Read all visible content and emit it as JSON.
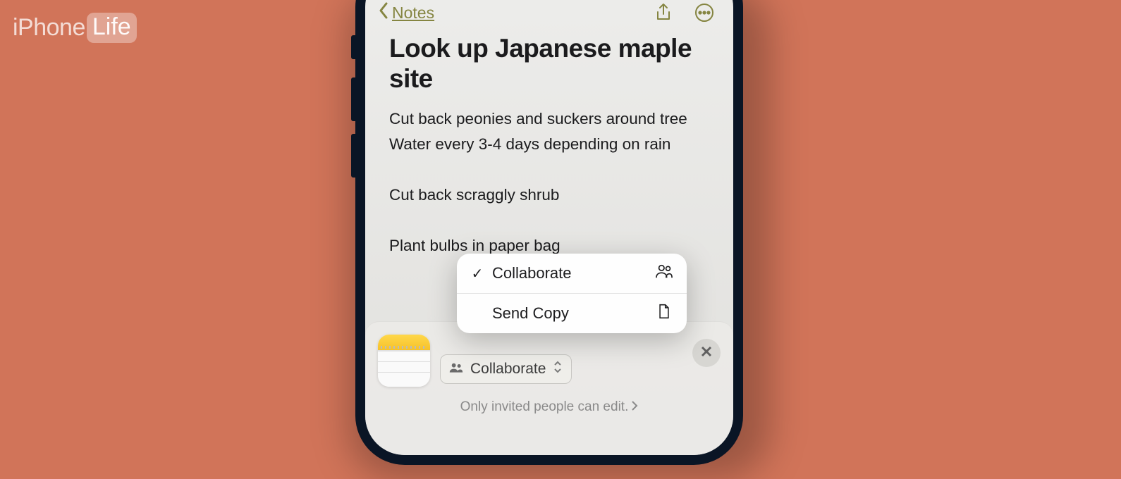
{
  "watermark": {
    "brand_left": "iPhone",
    "brand_right": "Life"
  },
  "nav": {
    "back_label": "Notes"
  },
  "note": {
    "title": "Look up Japanese maple site",
    "lines": [
      "Cut back peonies and suckers around tree",
      "Water every 3-4 days depending on rain",
      "",
      "Cut back scraggly shrub",
      "",
      "Plant bulbs in paper bag"
    ]
  },
  "popup": {
    "options": [
      {
        "label": "Collaborate",
        "selected": true,
        "icon": "people"
      },
      {
        "label": "Send Copy",
        "selected": false,
        "icon": "doc"
      }
    ]
  },
  "sheet": {
    "mode_label": "Collaborate",
    "permission_text": "Only invited people can edit."
  }
}
